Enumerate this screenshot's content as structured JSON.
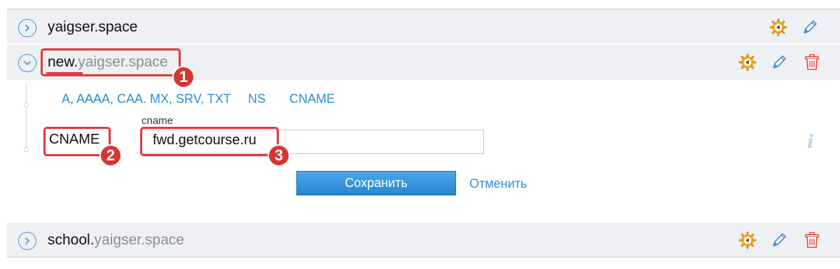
{
  "domains": [
    {
      "sub": "",
      "base": "yaigser.space"
    },
    {
      "sub": "new.",
      "base": "yaigser.space"
    },
    {
      "sub": "school.",
      "base": "yaigser.space"
    }
  ],
  "record_types": {
    "tabs": [
      "A, AAAA, CAA. MX, SRV, TXT",
      "NS",
      "CNAME"
    ]
  },
  "form": {
    "type_label": "CNAME",
    "field_label": "cname",
    "field_value": "fwd.getcourse.ru",
    "save_label": "Сохранить",
    "cancel_label": "Отменить",
    "info_glyph": "i"
  },
  "annotations": [
    "1",
    "2",
    "3"
  ],
  "colors": {
    "accent": "#2e8fd6",
    "annotation": "#d83434",
    "row_bg": "#eef0f3"
  },
  "icons": {
    "expand": "chevron-right-circle-icon",
    "collapse": "chevron-down-circle-icon",
    "settings": "gear-arrow-icon",
    "edit": "pencil-icon",
    "delete": "trash-icon",
    "info": "info-icon"
  }
}
